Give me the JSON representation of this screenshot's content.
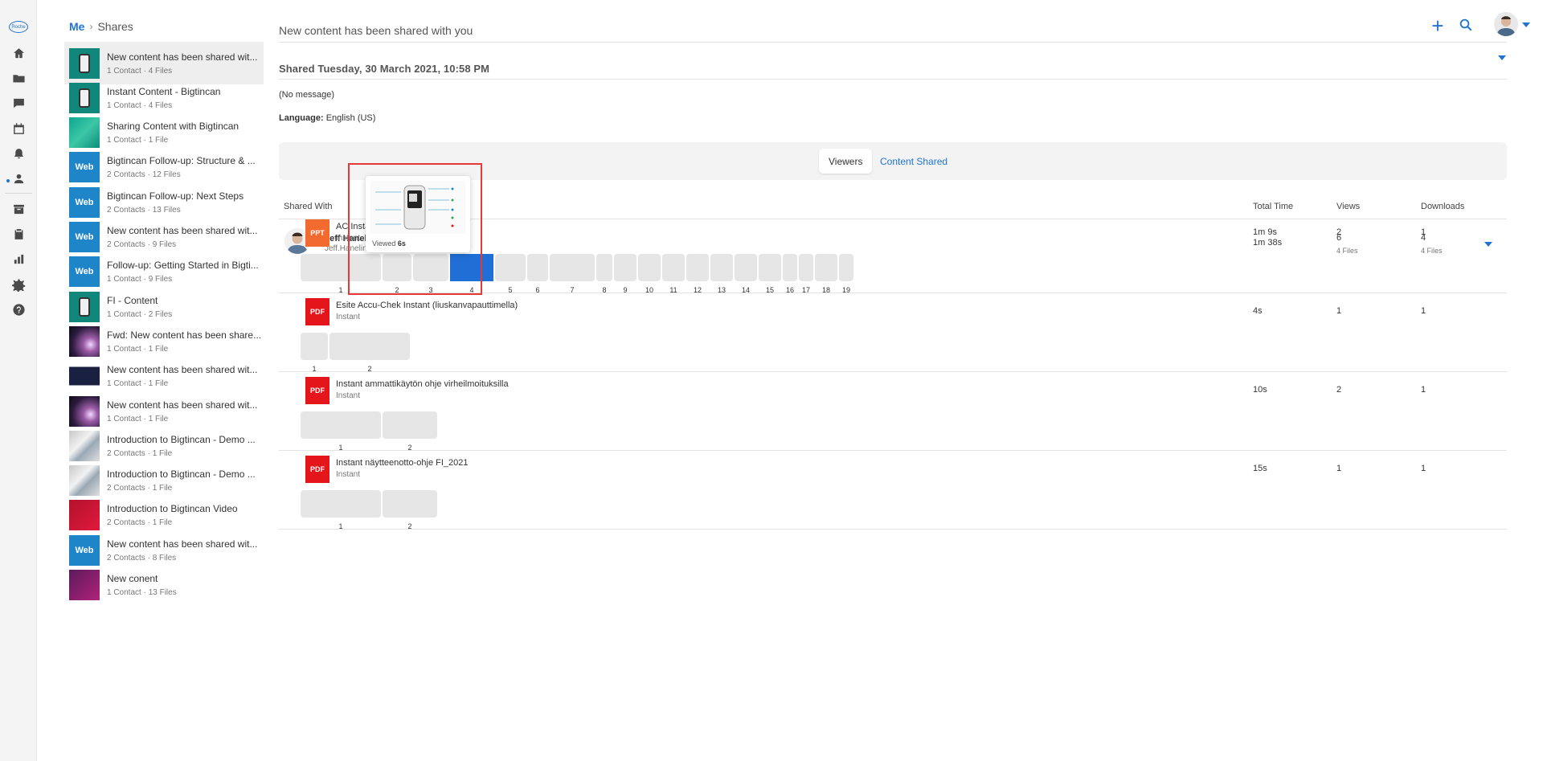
{
  "breadcrumb": {
    "root": "Me",
    "separator": "›",
    "current": "Shares"
  },
  "shares": [
    {
      "title": "New content has been shared wit...",
      "meta": "1 Contact · 4 Files",
      "thumb": "teal"
    },
    {
      "title": "Instant Content - Bigtincan",
      "meta": "1 Contact · 4 Files",
      "thumb": "teal"
    },
    {
      "title": "Sharing Content with Bigtincan",
      "meta": "1 Contact · 1 File",
      "thumb": "teal2"
    },
    {
      "title": "Bigtincan Follow-up: Structure & ...",
      "meta": "2 Contacts · 12 Files",
      "thumb": "web",
      "label": "Web"
    },
    {
      "title": "Bigtincan Follow-up: Next Steps",
      "meta": "2 Contacts · 13 Files",
      "thumb": "web",
      "label": "Web"
    },
    {
      "title": "New content has been shared wit...",
      "meta": "2 Contacts · 9 Files",
      "thumb": "web",
      "label": "Web"
    },
    {
      "title": "Follow-up: Getting Started in Bigti...",
      "meta": "1 Contact · 9 Files",
      "thumb": "web",
      "label": "Web"
    },
    {
      "title": "FI - Content",
      "meta": "1 Contact · 2 Files",
      "thumb": "teal"
    },
    {
      "title": "Fwd: New content has been share...",
      "meta": "1 Contact · 1 File",
      "thumb": "space"
    },
    {
      "title": "New content has been shared wit...",
      "meta": "1 Contact · 1 File",
      "thumb": "video"
    },
    {
      "title": "New content has been shared wit...",
      "meta": "1 Contact · 1 File",
      "thumb": "space"
    },
    {
      "title": "Introduction to Bigtincan - Demo ...",
      "meta": "2 Contacts · 1 File",
      "thumb": "photo"
    },
    {
      "title": "Introduction to Bigtincan - Demo ...",
      "meta": "2 Contacts · 1 File",
      "thumb": "photo"
    },
    {
      "title": "Introduction to Bigtincan Video",
      "meta": "2 Contacts · 1 File",
      "thumb": "red"
    },
    {
      "title": "New content has been shared wit...",
      "meta": "2 Contacts · 8 Files",
      "thumb": "web",
      "label": "Web"
    },
    {
      "title": "New conent",
      "meta": "1 Contact · 13 Files",
      "thumb": "purple"
    }
  ],
  "header": {
    "title": "New content has been shared with you",
    "plus_label": "+"
  },
  "detail": {
    "shared_date": "Shared Tuesday, 30 March 2021, 10:58 PM",
    "message": "(No message)",
    "language_label": "Language:",
    "language_value": "English (US)"
  },
  "tabs": {
    "viewers": "Viewers",
    "content": "Content Shared"
  },
  "columns": {
    "shared_with": "Shared With",
    "total_time": "Total Time",
    "views": "Views",
    "downloads": "Downloads"
  },
  "viewer": {
    "name": "Jeff Haneline",
    "email": "Jeff.Haneline@Contractors.Roche.C",
    "total_time": "1m 38s",
    "views": "6",
    "views_sub": "4 Files",
    "downloads": "4",
    "downloads_sub": "4 Files"
  },
  "files": [
    {
      "type": "PPT",
      "name": "AC Instant laajan yleiskä",
      "sub": "Instant",
      "time": "1m 9s",
      "views": "2",
      "downloads": "1",
      "pages": [
        "1",
        "2",
        "3",
        "4",
        "5",
        "6",
        "7",
        "8",
        "9",
        "10",
        "11",
        "12",
        "13",
        "14",
        "15",
        "16",
        "17",
        "18",
        "19"
      ]
    },
    {
      "type": "PDF",
      "name": "Esite Accu-Chek Instant (liuskanvapauttimella)",
      "sub": "Instant",
      "time": "4s",
      "views": "1",
      "downloads": "1",
      "pages": [
        "1",
        "2"
      ]
    },
    {
      "type": "PDF",
      "name": "Instant ammattikäytön ohje virheilmoituksilla",
      "sub": "Instant",
      "time": "10s",
      "views": "2",
      "downloads": "1",
      "pages": [
        "1",
        "2"
      ]
    },
    {
      "type": "PDF",
      "name": "Instant näytteenotto-ohje FI_2021",
      "sub": "Instant",
      "time": "15s",
      "views": "1",
      "downloads": "1",
      "pages": [
        "1",
        "2"
      ]
    }
  ],
  "preview": {
    "label": "Viewed",
    "value": "6s"
  },
  "colors": {
    "accent": "#1f74d2",
    "ppt": "#f26a2d",
    "pdf": "#e5151c",
    "highlight": "#e53935"
  }
}
